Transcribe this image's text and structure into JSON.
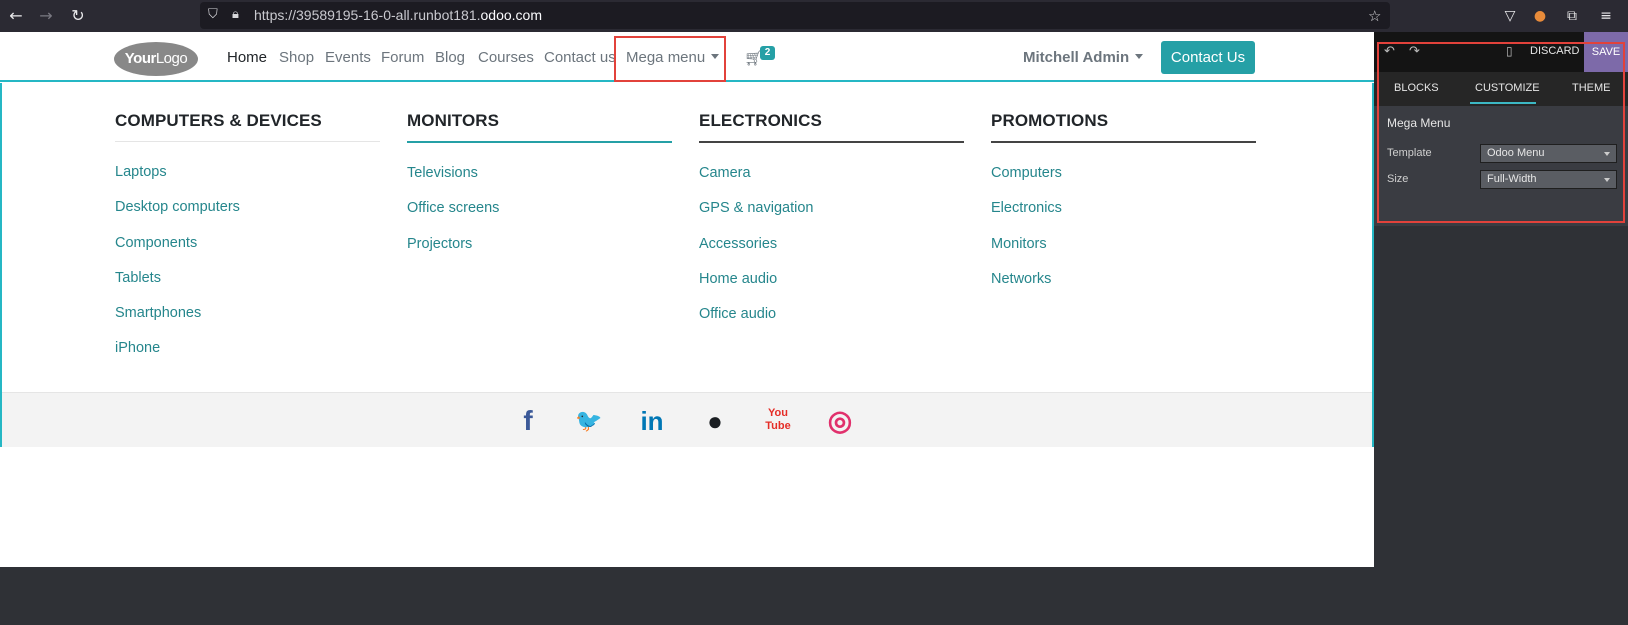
{
  "browser": {
    "url_prefix": "https://39589195-16-0-all.runbot181.",
    "url_domain": "odoo.com"
  },
  "header": {
    "logo_bold": "Your",
    "logo_thin": "Logo",
    "menu": [
      {
        "label": "Home"
      },
      {
        "label": "Shop"
      },
      {
        "label": "Events"
      },
      {
        "label": "Forum"
      },
      {
        "label": "Blog"
      },
      {
        "label": "Courses"
      },
      {
        "label": "Contact us"
      },
      {
        "label": "Mega menu"
      }
    ],
    "cart_count": "2",
    "user": "Mitchell Admin",
    "contact_button": "Contact Us"
  },
  "mega_menu": {
    "columns": [
      {
        "title": "COMPUTERS & DEVICES",
        "links": [
          "Laptops",
          "Desktop computers",
          "Components",
          "Tablets",
          "Smartphones",
          "iPhone"
        ]
      },
      {
        "title": "MONITORS",
        "links": [
          "Televisions",
          "Office screens",
          "Projectors"
        ]
      },
      {
        "title": "ELECTRONICS",
        "links": [
          "Camera",
          "GPS & navigation",
          "Accessories",
          "Home audio",
          "Office audio"
        ]
      },
      {
        "title": "PROMOTIONS",
        "links": [
          "Computers",
          "Electronics",
          "Monitors",
          "Networks"
        ]
      }
    ],
    "social": [
      {
        "icon": "facebook-icon",
        "glyph": "f",
        "color": "#3b5998"
      },
      {
        "icon": "twitter-icon",
        "glyph": "🐦",
        "color": "#1da1f2"
      },
      {
        "icon": "linkedin-icon",
        "glyph": "in",
        "color": "#0077b5"
      },
      {
        "icon": "github-icon",
        "glyph": "●",
        "color": "#1a1e22"
      },
      {
        "icon": "youtube-icon",
        "glyph": "You Tube",
        "color": "#e52d27"
      },
      {
        "icon": "instagram-icon",
        "glyph": "◎",
        "color": "#e1306c"
      }
    ]
  },
  "editor": {
    "discard": "DISCARD",
    "save": "SAVE",
    "tabs": [
      "BLOCKS",
      "CUSTOMIZE",
      "THEME"
    ],
    "section_title": "Mega Menu",
    "template_label": "Template",
    "template_value": "Odoo Menu",
    "size_label": "Size",
    "size_value": "Full-Width"
  }
}
